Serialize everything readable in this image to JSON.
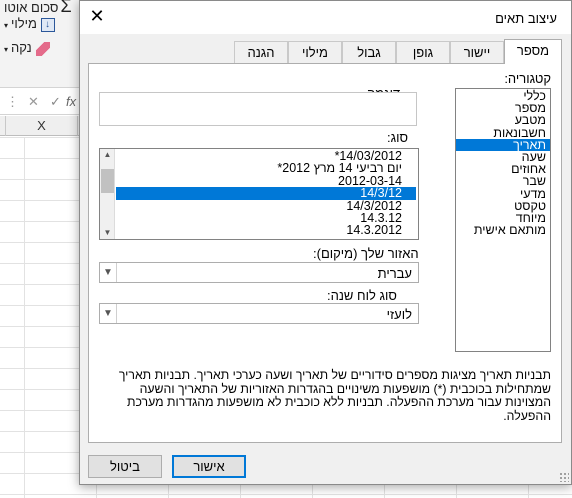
{
  "excel": {
    "ribbon_items": [
      "סכום אוטו",
      "מילוי",
      "נקה"
    ],
    "col_x": "X",
    "fx": "fx"
  },
  "dialog": {
    "title": "עיצוב תאים",
    "close": "✕",
    "tabs": [
      "מספר",
      "יישור",
      "גופן",
      "גבול",
      "מילוי",
      "הגנה"
    ],
    "category_label": "קטגוריה:",
    "categories": [
      "כללי",
      "מספר",
      "מטבע",
      "חשבונאות",
      "תאריך",
      "שעה",
      "אחוזים",
      "שבר",
      "מדעי",
      "טקסט",
      "מיוחד",
      "מותאם אישית"
    ],
    "selected_category": 4,
    "sample_label": "דוגמה",
    "sample_value": "",
    "type_label": "סוג:",
    "types": [
      "*14/03/2012",
      "*יום רביעי 14 מרץ 2012",
      "2012-03-14",
      "14/3/12",
      "14/3/2012",
      "14.3.12",
      "14.3.2012"
    ],
    "selected_type": 3,
    "locale_label": "האזור שלך (מיקום):",
    "locale_value": "עברית",
    "calendar_label": "סוג לוח שנה:",
    "calendar_value": "לועזי",
    "description": "תבניות תאריך מציגות מספרים סידוריים של תאריך ושעה כערכי תאריך. תבניות תאריך שמתחילות בכוכבית (*) מושפעות משינויים בהגדרות האזוריות של התאריך והשעה המצוינות עבור מערכת ההפעלה. תבניות ללא כוכבית לא מושפעות מהגדרות מערכת ההפעלה.",
    "ok": "אישור",
    "cancel": "ביטול"
  },
  "colors": {
    "accent": "#0078d7",
    "panel": "#f0f0f0"
  }
}
